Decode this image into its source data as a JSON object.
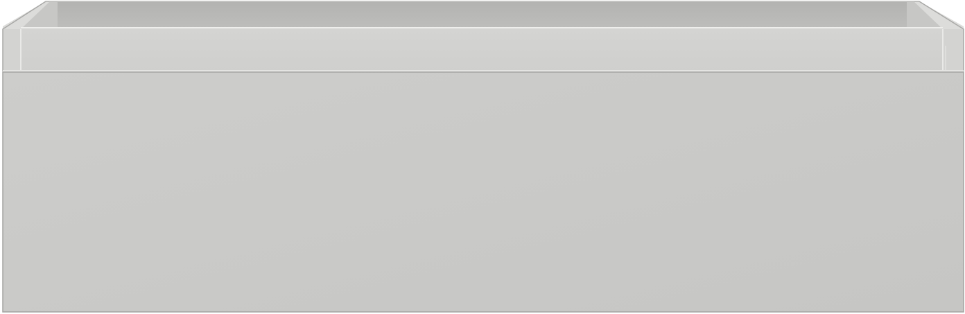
{
  "product": {
    "name": "",
    "colors": {
      "background": "#ffffff",
      "front_panel": "#cbcbc9",
      "front_panel_edge": "#a9a9a7",
      "inner_back_wall": "#b8b8b6",
      "inner_side_wall": "#c4c4c2",
      "rim": "#dededc",
      "drawer_box": "#d1d1cf",
      "outline": "#9c9c9a"
    }
  }
}
